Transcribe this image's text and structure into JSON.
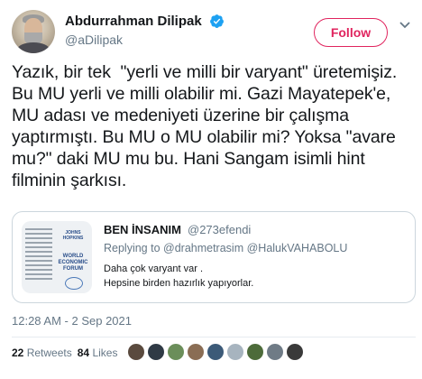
{
  "author": {
    "display_name": "Abdurrahman Dilipak",
    "handle": "@aDilipak",
    "verified": true,
    "avatar_icon": "profile-photo"
  },
  "follow_button": {
    "label": "Follow",
    "color": "#e0245e"
  },
  "tweet": {
    "text": "Yazık, bir tek  \"yerli ve milli bir varyant\" üretemişiz. Bu MU yerli ve milli olabilir mi. Gazi Mayatepek'e, MU adası ve medeniyeti üzerine bir çalışma yaptırmıştı. Bu MU o MU olabilir mi? Yoksa \"avare mu?\" daki MU mu bu. Hani Sangam isimli hint filminin şarkısı.",
    "timestamp": "12:28 AM - 2 Sep 2021"
  },
  "quoted_tweet": {
    "display_name": "BEN İNSANIM",
    "handle": "@273efendi",
    "replying_prefix": "Replying to ",
    "replying_to_1": "@drahmetrasim",
    "replying_to_2": "@HalukVAHABOLU",
    "text_line_1": "Daha çok varyant var .",
    "text_line_2": "Hepsine birden hazırlık yapıyorlar.",
    "image": {
      "logo_text": "JOHNS HOPKINS",
      "forum_text": "WORLD ECONOMIC FORUM"
    }
  },
  "stats": {
    "retweets_count": "22",
    "retweets_label": "Retweets",
    "likes_count": "84",
    "likes_label": "Likes"
  },
  "likers": [
    {
      "color": "#5a4a3e"
    },
    {
      "color": "#2f3a45"
    },
    {
      "color": "#6b8e5a"
    },
    {
      "color": "#8a6d54"
    },
    {
      "color": "#3c5a78"
    },
    {
      "color": "#a7b4bf"
    },
    {
      "color": "#4d6b3a"
    },
    {
      "color": "#6f7b86"
    },
    {
      "color": "#3a3a3a"
    }
  ],
  "colors": {
    "text": "#14171a",
    "secondary": "#657786",
    "verified": "#1da1f2",
    "border": "#ccd6dd"
  }
}
